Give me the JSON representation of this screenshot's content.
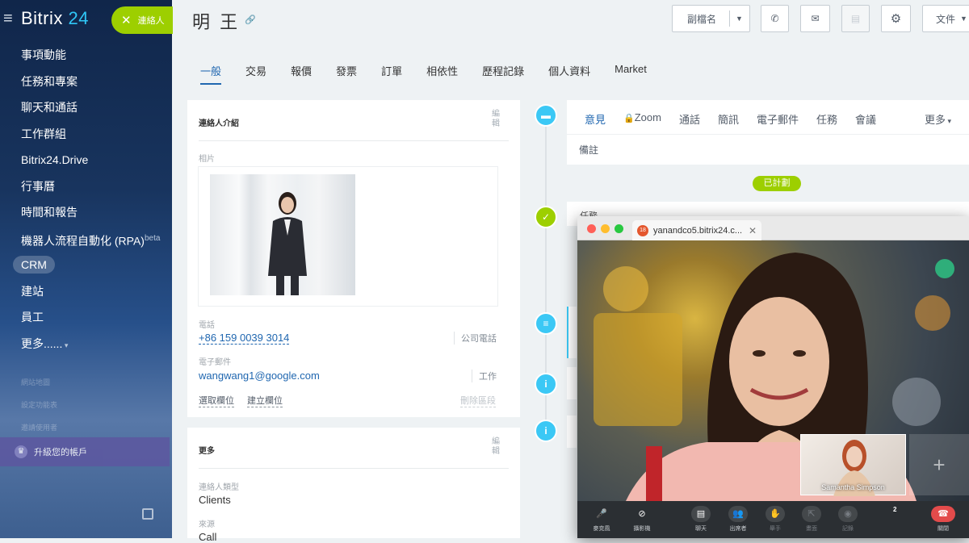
{
  "sidebar": {
    "brand_main": "Bitrix",
    "brand_num": " 24",
    "items": [
      "事項動能",
      "任務和專案",
      "聊天和通話",
      "工作群組",
      "Bitrix24.Drive",
      "行事曆",
      "時間和報告",
      "機器人流程自動化 (RPA)",
      "CRM",
      "建站",
      "員工",
      "更多......"
    ],
    "rpa_sup": "beta",
    "sub_items": [
      "網站地圖",
      "設定功能表",
      "邀請使用者"
    ],
    "upgrade": "升級您的帳戶"
  },
  "chip": {
    "label": "連絡人"
  },
  "header": {
    "title": "明 王",
    "buttons": {
      "alias": "副檔名",
      "docs": "文件"
    }
  },
  "tabs": [
    "一般",
    "交易",
    "報價",
    "發票",
    "訂單",
    "相依性",
    "歷程記錄",
    "個人資料",
    "Market"
  ],
  "contact_card": {
    "title": "連絡人介紹",
    "edit": "編輯",
    "photo_label": "相片",
    "phone_label": "電話",
    "phone": "+86 159 0039 3014",
    "phone_type": "公司電話",
    "email_label": "電子郵件",
    "email": "wangwang1@google.com",
    "email_type": "工作",
    "select_field": "選取欄位",
    "create_field": "建立欄位",
    "delete_section": "刪除區段"
  },
  "more_card": {
    "title": "更多",
    "edit": "編輯",
    "type_label": "連絡人類型",
    "type_value": "Clients",
    "source_label": "來源",
    "source_value": "Call"
  },
  "composer": {
    "tabs": [
      "意見",
      "Zoom",
      "通話",
      "簡訊",
      "電子郵件",
      "任務",
      "會議"
    ],
    "more": "更多",
    "note": "備註"
  },
  "planned": "已計劃",
  "task_title": "任務",
  "video": {
    "tab_title": "yanandco5.bitrix24.c...",
    "tab_badge": "18",
    "pip_name": "Samantha Simpson",
    "controls": [
      "麥克風",
      "攝影機",
      "聊天",
      "出席者",
      "舉手",
      "畫面",
      "記錄",
      "關閉"
    ],
    "participants_count": "2"
  },
  "colors": {
    "accent": "#2067b0",
    "green": "#9dcf00",
    "timeline_blue": "#3bc8f5"
  }
}
